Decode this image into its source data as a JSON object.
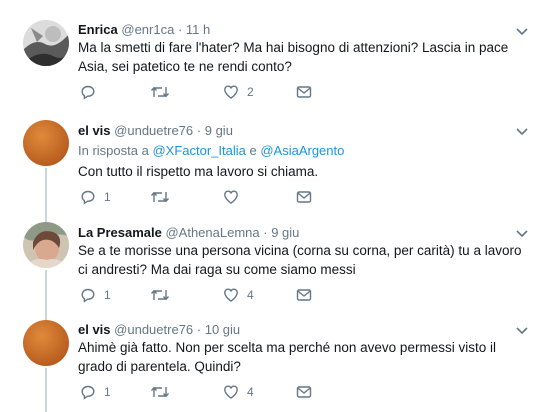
{
  "tweets": [
    {
      "name": "Enrica",
      "handle": "@enr1ca",
      "time": "11 h",
      "text": "Ma la smetti di fare l'hater? Ma hai bisogno di attenzioni? Lascia in pace Asia, sei patetico te ne rendi conto?",
      "reply": "",
      "like": "2"
    },
    {
      "name": "el vis",
      "handle": "@unduetre76",
      "time": "9 giu",
      "reply_prefix": "In risposta a",
      "reply_mention1": "@XFactor_Italia",
      "reply_and": "e",
      "reply_mention2": "@AsiaArgento",
      "text": "Con tutto il rispetto ma lavoro si chiama.",
      "reply": "1",
      "like": ""
    },
    {
      "name": "La Presamale",
      "handle": "@AthenaLemna",
      "time": "9 giu",
      "text": "Se a te morisse una persona vicina (corna su corna, per carità) tu a lavoro ci andresti? Ma dai raga su come siamo messi",
      "reply": "1",
      "like": "4"
    },
    {
      "name": "el vis",
      "handle": "@unduetre76",
      "time": "10 giu",
      "text": "Ahimè già fatto. Non per scelta ma perché non avevo permessi visto il grado di parentela. Quindi?",
      "reply": "1",
      "like": "4"
    }
  ],
  "separator": "·",
  "colors": {
    "text": "#14171a",
    "secondary": "#657786",
    "link": "#1b95e0",
    "border": "#e6ecf0",
    "thread_line": "#ccd6dd",
    "icon": "#657786"
  },
  "icons": [
    "reply-icon",
    "retweet-icon",
    "like-icon",
    "direct-message-icon",
    "chevron-down-icon"
  ]
}
